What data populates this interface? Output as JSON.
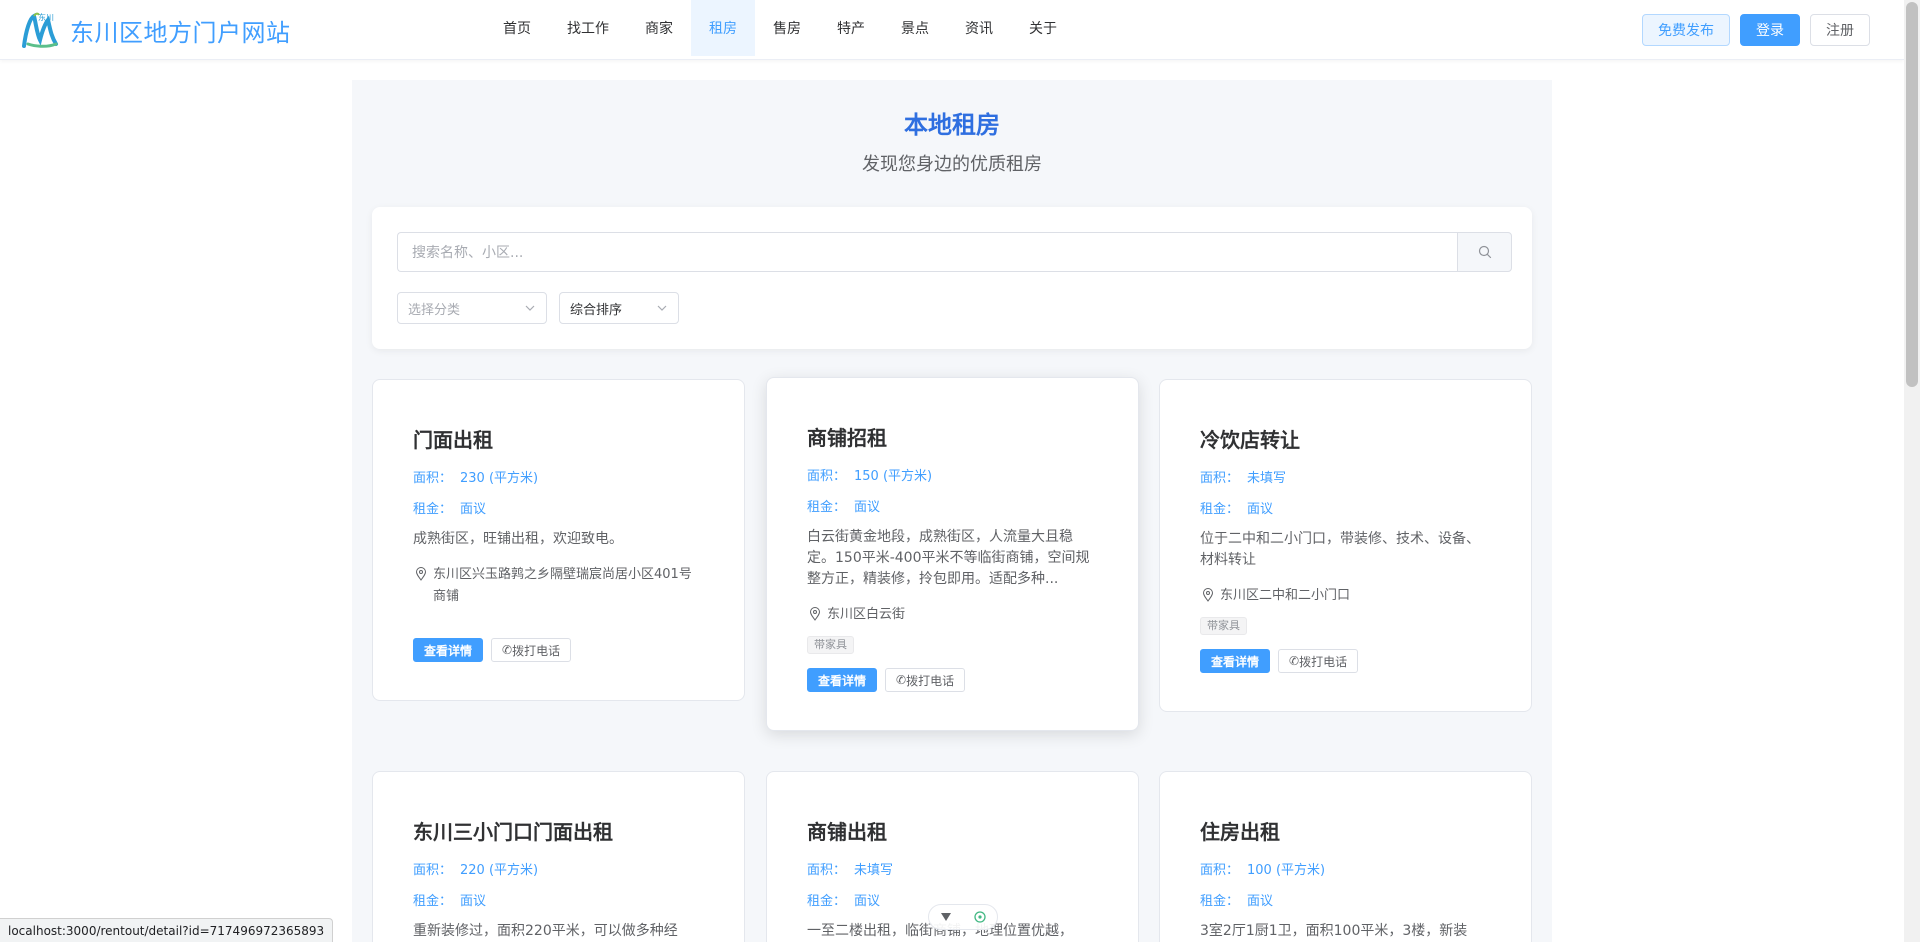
{
  "header": {
    "site_title": "东川区地方门户网站",
    "logo_text": "东川",
    "nav": [
      "首页",
      "找工作",
      "商家",
      "租房",
      "售房",
      "特产",
      "景点",
      "资讯",
      "关于"
    ],
    "active_nav": "租房",
    "publish_label": "免费发布",
    "login_label": "登录",
    "register_label": "注册"
  },
  "page": {
    "title": "本地租房",
    "subtitle": "发现您身边的优质租房"
  },
  "search": {
    "placeholder": "搜索名称、小区...",
    "category_placeholder": "选择分类",
    "sort_value": "综合排序"
  },
  "labels": {
    "area": "面积：",
    "rent": "租金：",
    "detail": "查看详情",
    "call": "拨打电话"
  },
  "listings": [
    {
      "title": "门面出租",
      "area": "230 (平方米)",
      "rent": "面议",
      "desc": "成熟街区，旺铺出租，欢迎致电。",
      "address": "东川区兴玉路鹑之乡隔壁瑞宸尚居小区401号商铺",
      "tags": []
    },
    {
      "title": "商铺招租",
      "area": "150 (平方米)",
      "rent": "面议",
      "desc": "白云街黄金地段，成熟街区，人流量大且稳定。150平米-400平米不等临街商铺，空间规整方正，精装修，拎包即用。适配多种...",
      "address": "东川区白云街",
      "tags": [
        "带家具"
      ]
    },
    {
      "title": "冷饮店转让",
      "area": "未填写",
      "rent": "面议",
      "desc": "位于二中和二小门口，带装修、技术、设备、材料转让",
      "address": "东川区二中和二小门口",
      "tags": [
        "带家具"
      ]
    },
    {
      "title": "东川三小门口门面出租",
      "area": "220 (平方米)",
      "rent": "面议",
      "desc": "重新装修过，面积220平米，可以做多种经",
      "address": "",
      "tags": []
    },
    {
      "title": "商铺出租",
      "area": "未填写",
      "rent": "面议",
      "desc": "一至二楼出租，临街商铺，地理位置优越，",
      "address": "",
      "tags": []
    },
    {
      "title": "住房出租",
      "area": "100 (平方米)",
      "rent": "面议",
      "desc": "3室2厅1厨1卫，面积100平米，3楼，新装",
      "address": "",
      "tags": []
    }
  ],
  "statusbar": {
    "url": "localhost:3000/rentout/detail?id=717496972365893"
  },
  "colors": {
    "accent": "#409eff",
    "title_blue": "#2f6fe0",
    "panel_bg": "#f5f7fa"
  }
}
